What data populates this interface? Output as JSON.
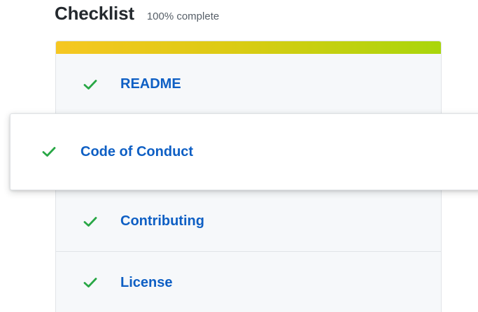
{
  "header": {
    "title": "Checklist",
    "subtitle": "100% complete"
  },
  "progress": {
    "value": 1.0
  },
  "checklist": {
    "items": [
      {
        "label": "README",
        "icon": "check-icon",
        "done": true
      },
      {
        "label": "Code of Conduct",
        "icon": "check-icon",
        "done": true
      },
      {
        "label": "Contributing",
        "icon": "check-icon",
        "done": true
      },
      {
        "label": "License",
        "icon": "check-icon",
        "done": true
      }
    ]
  },
  "colors": {
    "check": "#28a745",
    "link": "#0e5fc4",
    "progress_start": "#f6c722",
    "progress_end": "#a9d60b"
  }
}
